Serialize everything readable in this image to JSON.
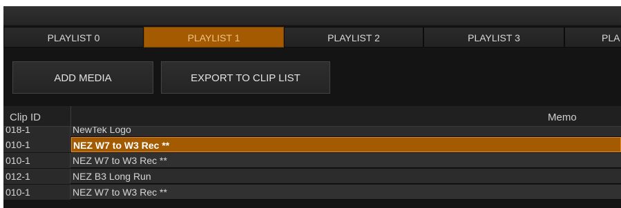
{
  "tabs": [
    {
      "label": "PLAYLIST 0",
      "active": false
    },
    {
      "label": "PLAYLIST 1",
      "active": true
    },
    {
      "label": "PLAYLIST 2",
      "active": false
    },
    {
      "label": "PLAYLIST 3",
      "active": false
    },
    {
      "label": "PLA",
      "active": false
    }
  ],
  "toolbar": {
    "add_media_label": "ADD MEDIA",
    "export_label": "EXPORT TO CLIP LIST"
  },
  "table": {
    "columns": {
      "clip_id": "Clip ID",
      "memo": "Memo"
    },
    "rows": [
      {
        "clip_id": "018-1",
        "memo": "NewTek Logo",
        "selected": false
      },
      {
        "clip_id": "010-1",
        "memo": "NEZ W7 to W3 Rec **",
        "selected": true
      },
      {
        "clip_id": "010-1",
        "memo": "NEZ W7 to W3 Rec **",
        "selected": false
      },
      {
        "clip_id": "012-1",
        "memo": "NEZ B3 Long Run",
        "selected": false
      },
      {
        "clip_id": "010-1",
        "memo": "NEZ W7 to W3 Rec **",
        "selected": false
      }
    ]
  },
  "colors": {
    "accent": "#a35a00",
    "background": "#141414"
  }
}
